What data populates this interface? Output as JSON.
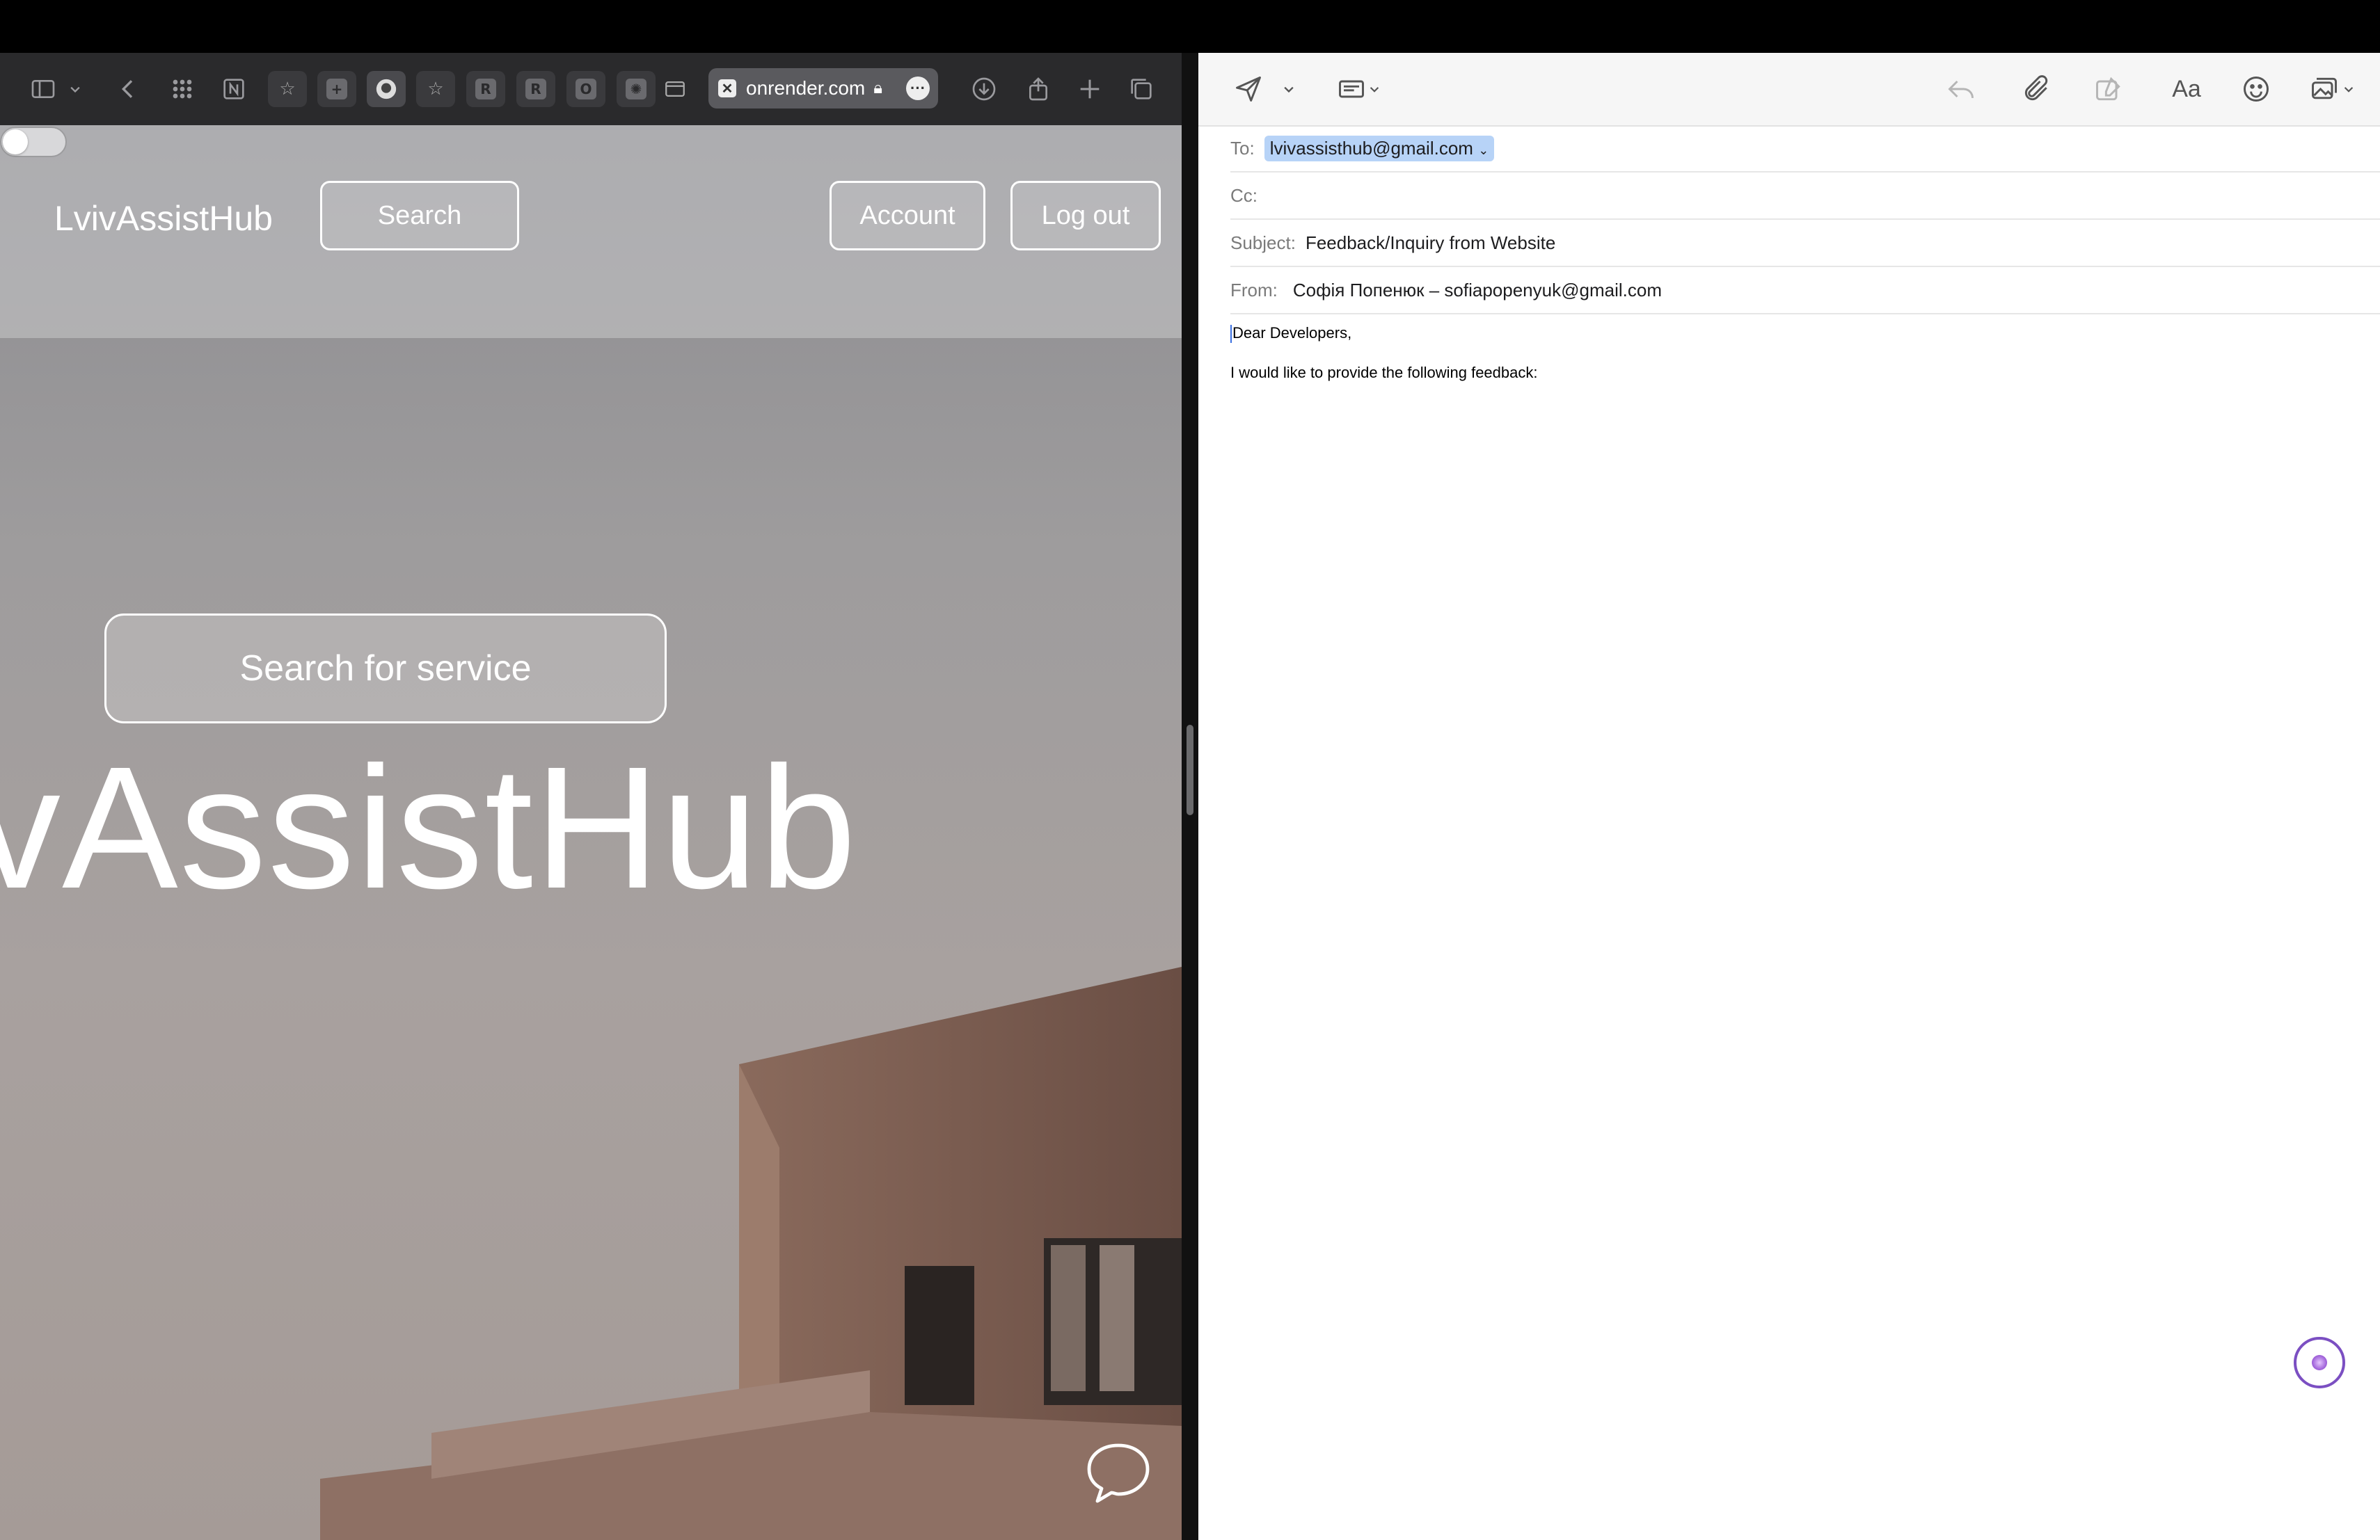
{
  "browser": {
    "address": "onrender.com",
    "favorites": [
      "N",
      "R",
      "R",
      "O"
    ]
  },
  "site": {
    "logo": "LvivAssistHub",
    "nav": {
      "search": "Search",
      "account": "Account",
      "logout": "Log out"
    },
    "search_service": "Search for service",
    "hero_text": "vAssistHub"
  },
  "mail": {
    "to_label": "To:",
    "to_value": "lvivassisthub@gmail.com",
    "cc_label": "Cc:",
    "subject_label": "Subject:",
    "subject_value": "Feedback/Inquiry from Website",
    "from_label": "From:",
    "from_value": "Софія Попенюк – sofiapopenyuk@gmail.com",
    "format_label": "Aa",
    "body": [
      "Dear Developers,",
      "I would like to provide the following feedback:"
    ]
  }
}
